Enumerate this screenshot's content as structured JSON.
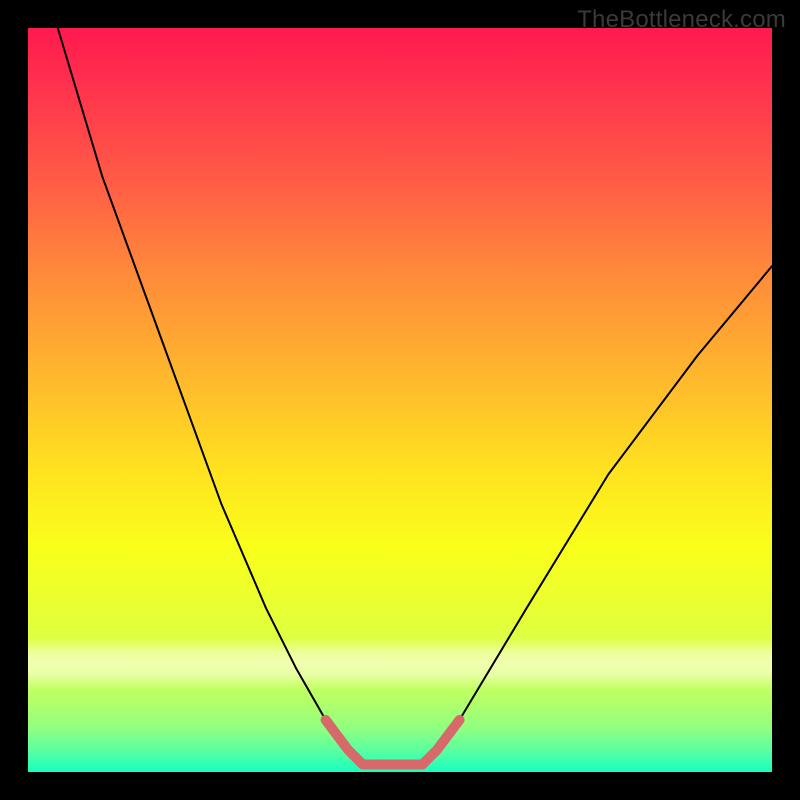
{
  "watermark": "TheBottleneck.com",
  "chart_data": {
    "type": "line",
    "title": "",
    "xlabel": "",
    "ylabel": "",
    "xlim": [
      0,
      100
    ],
    "ylim": [
      0,
      100
    ],
    "legend": false,
    "grid": false,
    "background_gradient": {
      "direction": "vertical",
      "stops": [
        {
          "pos": 0.0,
          "color": "#ff1a4f"
        },
        {
          "pos": 0.33,
          "color": "#ff8a3a"
        },
        {
          "pos": 0.6,
          "color": "#ffe41f"
        },
        {
          "pos": 0.85,
          "color": "#d6ff4d"
        },
        {
          "pos": 1.0,
          "color": "#18ffc0"
        }
      ]
    },
    "series": [
      {
        "name": "bottleneck-curve",
        "color": "#000000",
        "width": 2,
        "x": [
          4,
          10,
          18,
          26,
          32,
          36,
          40,
          43,
          45,
          47,
          50,
          53,
          55,
          58,
          67,
          78,
          90,
          100
        ],
        "y": [
          100,
          80,
          58,
          36,
          22,
          14,
          7,
          3,
          1,
          1,
          1,
          1,
          3,
          7,
          22,
          40,
          56,
          68
        ]
      },
      {
        "name": "optimal-zone-highlight",
        "color": "#d66a6a",
        "width": 10,
        "x": [
          40,
          43,
          45,
          47,
          50,
          53,
          55,
          58
        ],
        "y": [
          7,
          3,
          1,
          1,
          1,
          1,
          3,
          7
        ]
      }
    ],
    "annotations": []
  }
}
